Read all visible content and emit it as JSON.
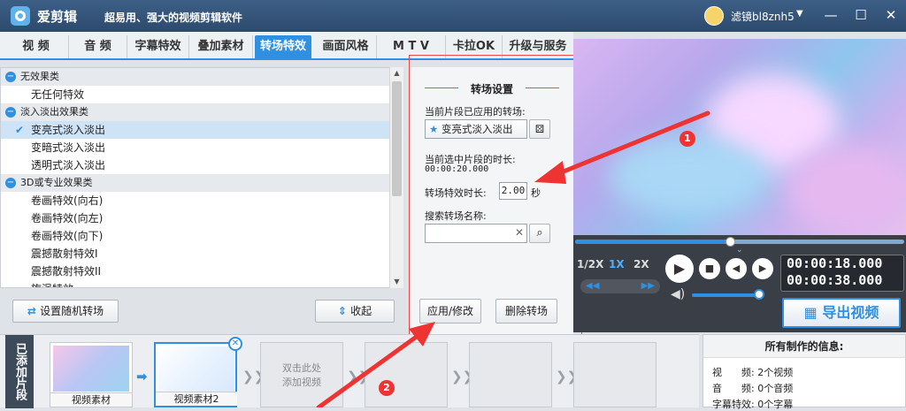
{
  "app": {
    "name": "爱剪辑",
    "slogan": "超易用、强大的视频剪辑软件",
    "user": "滤镜bl8znh5"
  },
  "tabs": [
    "视 频",
    "音 频",
    "字幕特效",
    "叠加素材",
    "转场特效",
    "画面风格",
    "M T V",
    "卡拉OK",
    "升级与服务"
  ],
  "active_tab": "转场特效",
  "effects": {
    "cat1": "无效果类",
    "cat1_items": [
      "无任何特效"
    ],
    "cat2": "淡入淡出效果类",
    "cat2_items": [
      "变亮式淡入淡出",
      "变暗式淡入淡出",
      "透明式淡入淡出"
    ],
    "cat3": "3D或专业效果类",
    "cat3_items": [
      "卷画特效(向右)",
      "卷画特效(向左)",
      "卷画特效(向下)",
      "震撼散射特效I",
      "震撼散射特效II",
      "旋涡特效"
    ]
  },
  "buttons": {
    "random": "设置随机转场",
    "collapse": "收起",
    "apply": "应用/修改",
    "delete": "删除转场",
    "export": "导出视频"
  },
  "settings": {
    "title": "转场设置",
    "applied_label": "当前片段已应用的转场:",
    "applied_value": "变亮式淡入淡出",
    "duration_label": "当前选中片段的时长:",
    "duration_value": "00:00:20.000",
    "effect_len_label": "转场特效时长:",
    "effect_len_value": "2.00",
    "effect_len_unit": "秒",
    "search_label": "搜索转场名称:",
    "search_value": ""
  },
  "player": {
    "progress": 0.47,
    "volume": 0.9,
    "speeds": [
      "1/2X",
      "1X",
      "2X"
    ],
    "active_speed": "1X",
    "current_time": "00:00:18.000",
    "total_time": "00:00:38.000"
  },
  "clips": {
    "label": "已添加片段",
    "items": [
      "视频素材",
      "视频素材2"
    ],
    "add_hint": "双击此处\n添加视频"
  },
  "info": {
    "title": "所有制作的信息:",
    "rows": [
      {
        "label": "视　　频:",
        "value": "2个视频"
      },
      {
        "label": "音　　频:",
        "value": "0个音频"
      },
      {
        "label": "字幕特效:",
        "value": "0个字幕"
      }
    ]
  },
  "annotations": [
    "1",
    "2"
  ],
  "colors": {
    "accent": "#2f8fe0",
    "titlebar": "#34557a",
    "annotation": "#e33333"
  }
}
